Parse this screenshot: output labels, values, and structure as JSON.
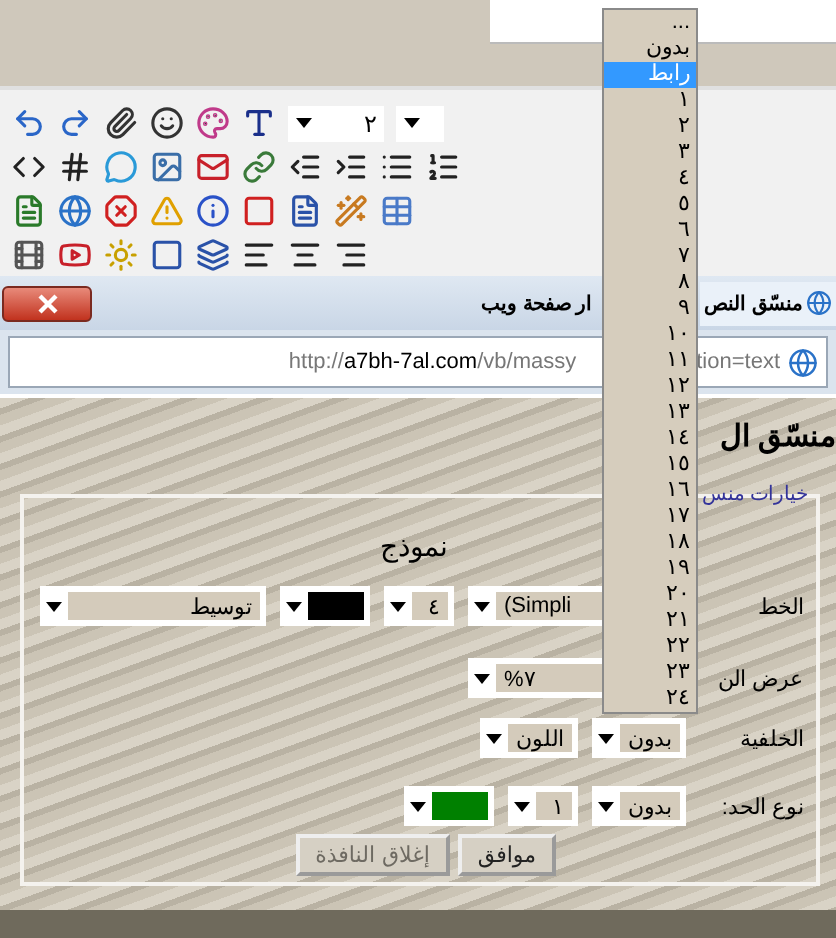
{
  "toolbar": {
    "font_size": "٢"
  },
  "browser": {
    "tabs": [
      {
        "label": "منسّق النص",
        "selected": true
      },
      {
        "label": "ار صفحة ويب",
        "selected": false
      }
    ],
    "address": {
      "scheme": "http://",
      "domain": "a7bh-7al.com",
      "path": "/vb/massy",
      "tail": "tion=text"
    }
  },
  "page": {
    "heading": "منسّق ال",
    "legend": "خيارات منس",
    "form_title": "نموذج",
    "rows": [
      {
        "label": "الخط",
        "fields": [
          {
            "kind": "long",
            "value": "(Simpli"
          },
          {
            "kind": "select",
            "value": "٤"
          },
          {
            "kind": "swatch",
            "color": "#000000"
          },
          {
            "kind": "wide",
            "value": "توسيط"
          }
        ]
      },
      {
        "label": "عرض الن",
        "fields": [
          {
            "kind": "long",
            "value": "%٧"
          }
        ]
      },
      {
        "label": "الخلفية",
        "fields": [
          {
            "kind": "select",
            "value": "بدون"
          },
          {
            "kind": "select",
            "value": "اللون"
          }
        ]
      },
      {
        "label": "نوع الحد:",
        "fields": [
          {
            "kind": "select",
            "value": "بدون"
          },
          {
            "kind": "select",
            "value": "١"
          },
          {
            "kind": "swatch",
            "color": "#008000"
          }
        ]
      }
    ],
    "buttons": [
      {
        "label": "موافق",
        "disabled": false
      },
      {
        "label": "إغلاق النافذة",
        "disabled": true
      }
    ]
  },
  "dropdown_list": {
    "items": [
      {
        "label": "...",
        "selected": false
      },
      {
        "label": "بدون",
        "selected": false
      },
      {
        "label": "رابط",
        "selected": true
      },
      {
        "label": "١",
        "selected": false
      },
      {
        "label": "٢",
        "selected": false
      },
      {
        "label": "٣",
        "selected": false
      },
      {
        "label": "٤",
        "selected": false
      },
      {
        "label": "٥",
        "selected": false
      },
      {
        "label": "٦",
        "selected": false
      },
      {
        "label": "٧",
        "selected": false
      },
      {
        "label": "٨",
        "selected": false
      },
      {
        "label": "٩",
        "selected": false
      },
      {
        "label": "١٠",
        "selected": false
      },
      {
        "label": "١١",
        "selected": false
      },
      {
        "label": "١٢",
        "selected": false
      },
      {
        "label": "١٣",
        "selected": false
      },
      {
        "label": "١٤",
        "selected": false
      },
      {
        "label": "١٥",
        "selected": false
      },
      {
        "label": "١٦",
        "selected": false
      },
      {
        "label": "١٧",
        "selected": false
      },
      {
        "label": "١٨",
        "selected": false
      },
      {
        "label": "١٩",
        "selected": false
      },
      {
        "label": "٢٠",
        "selected": false
      },
      {
        "label": "٢١",
        "selected": false
      },
      {
        "label": "٢٢",
        "selected": false
      },
      {
        "label": "٢٣",
        "selected": false
      },
      {
        "label": "٢٤",
        "selected": false
      }
    ]
  }
}
